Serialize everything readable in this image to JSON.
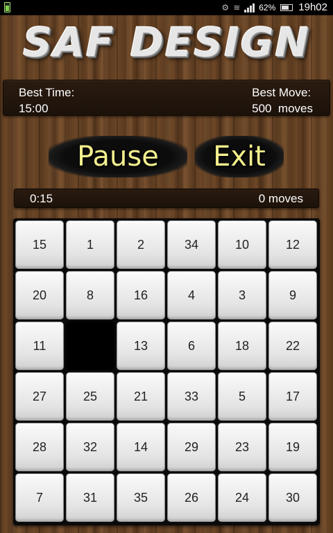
{
  "status_bar": {
    "battery_percent": "62%",
    "time": "19h02"
  },
  "logo": {
    "text": "SAF DESIGN"
  },
  "best": {
    "time_label": "Best Time:",
    "time_value": "15:00",
    "moves_label": "Best Move:",
    "moves_value": "500  moves"
  },
  "buttons": {
    "pause_label": "Pause",
    "exit_label": "Exit"
  },
  "progress": {
    "elapsed": "0:15",
    "moves": "0 moves"
  },
  "board": {
    "rows": 6,
    "cols": 6,
    "tiles": [
      "15",
      "1",
      "2",
      "34",
      "10",
      "12",
      "20",
      "8",
      "16",
      "4",
      "3",
      "9",
      "11",
      "",
      "13",
      "6",
      "18",
      "22",
      "27",
      "25",
      "21",
      "33",
      "5",
      "17",
      "28",
      "32",
      "14",
      "29",
      "23",
      "19",
      "7",
      "31",
      "35",
      "26",
      "24",
      "30"
    ]
  },
  "colors": {
    "button_text": "#f3ef8e",
    "panel_bg": "#1c120a",
    "empty_tile": "#000000"
  }
}
